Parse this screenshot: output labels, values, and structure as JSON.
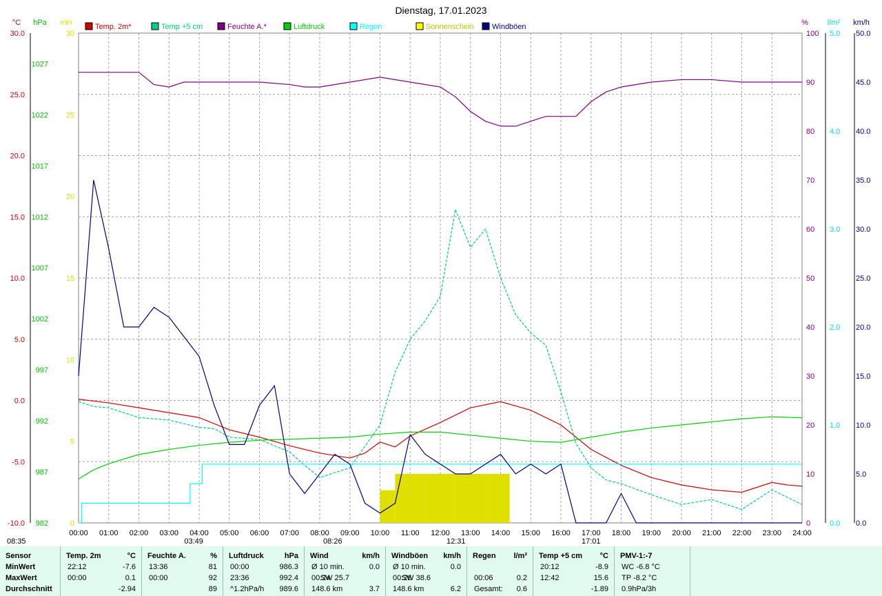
{
  "chart_data": {
    "type": "line",
    "title": "Dienstag, 17.01.2023",
    "x_ticks": [
      "00:00",
      "01:00",
      "02:00",
      "03:00",
      "04:00",
      "05:00",
      "06:00",
      "07:00",
      "08:00",
      "09:00",
      "10:00",
      "11:00",
      "12:00",
      "13:00",
      "14:00",
      "15:00",
      "16:00",
      "17:00",
      "18:00",
      "19:00",
      "20:00",
      "21:00",
      "22:00",
      "23:00",
      "24:00"
    ],
    "axes": {
      "temp": {
        "unit": "°C",
        "ylim": [
          -10,
          30
        ],
        "ticks": [
          "30.0",
          "25.0",
          "20.0",
          "15.0",
          "10.0",
          "5.0",
          "0.0",
          "-5.0",
          "-10.0"
        ],
        "color": "#d00000"
      },
      "pressure": {
        "unit": "hPa",
        "ylim": [
          982,
          1030
        ],
        "ticks": [
          "1027",
          "1022",
          "1017",
          "1012",
          "1007",
          "1002",
          "997",
          "992",
          "987",
          "982"
        ],
        "color": "#00c000"
      },
      "sun": {
        "unit": "min",
        "ylim": [
          0,
          30
        ],
        "ticks": [
          "30",
          "25",
          "20",
          "15",
          "10",
          "5",
          "0"
        ],
        "color": "#e0e000"
      },
      "humidity": {
        "unit": "%",
        "ylim": [
          0,
          100
        ],
        "ticks": [
          "100",
          "90",
          "80",
          "70",
          "60",
          "50",
          "40",
          "30",
          "20",
          "10",
          "0"
        ],
        "color": "#800080"
      },
      "rain": {
        "unit": "l/m²",
        "ylim": [
          0,
          5
        ],
        "ticks": [
          "5.0",
          "4.0",
          "3.0",
          "2.0",
          "1.0",
          "0.0"
        ],
        "color": "#00e0e0"
      },
      "wind": {
        "unit": "km/h",
        "ylim": [
          0,
          50
        ],
        "ticks": [
          "50.0",
          "45.0",
          "40.0",
          "35.0",
          "30.0",
          "25.0",
          "20.0",
          "15.0",
          "10.0",
          "5.0",
          "0.0"
        ],
        "color": "#000080"
      }
    },
    "legend": [
      {
        "name": "Temp. 2m*",
        "color": "#d00000"
      },
      {
        "name": "Temp +5 cm",
        "color": "#00d080"
      },
      {
        "name": "Feuchte A.*",
        "color": "#800080"
      },
      {
        "name": "Luftdruck",
        "color": "#00d000"
      },
      {
        "name": "Regen",
        "color": "#00ffff"
      },
      {
        "name": "Sonnenschein",
        "color": "#ffff00"
      },
      {
        "name": "Windböen",
        "color": "#000080"
      }
    ],
    "markers": [
      "03:49",
      "08:26",
      "12:31",
      "17:01",
      "08:35"
    ],
    "series": [
      {
        "name": "Temp. 2m*",
        "axis": "temp",
        "x": [
          0,
          1,
          2,
          3,
          4,
          5,
          6,
          7,
          8,
          9,
          9.5,
          10,
          10.5,
          11,
          12,
          13,
          14,
          15,
          16,
          17,
          18,
          19,
          20,
          21,
          22,
          23,
          23.5,
          24
        ],
        "values": [
          0.1,
          -0.2,
          -0.6,
          -1.0,
          -1.4,
          -2.4,
          -3.0,
          -3.7,
          -4.3,
          -4.7,
          -4.3,
          -3.4,
          -3.8,
          -2.9,
          -1.8,
          -0.6,
          -0.1,
          -0.8,
          -2.0,
          -4.0,
          -5.3,
          -6.3,
          -6.9,
          -7.3,
          -7.5,
          -6.7,
          -6.9,
          -7.0
        ]
      },
      {
        "name": "Temp +5 cm",
        "axis": "temp",
        "x": [
          0,
          0.5,
          1,
          1.5,
          2,
          3,
          4,
          4.5,
          5,
          6,
          7,
          7.5,
          8,
          9,
          10,
          10.5,
          11,
          11.5,
          12,
          12.5,
          13,
          13.5,
          14,
          14.5,
          15,
          15.5,
          16,
          16.5,
          17,
          17.5,
          18,
          19,
          20,
          21,
          22,
          23,
          24
        ],
        "values": [
          -0.1,
          -0.5,
          -0.6,
          -1.0,
          -1.4,
          -1.6,
          -2.2,
          -2.3,
          -3.0,
          -3.2,
          -4.2,
          -5.3,
          -6.3,
          -5.5,
          -2.0,
          2.3,
          5.0,
          6.5,
          8.5,
          15.6,
          12.5,
          14.0,
          10.0,
          7.0,
          5.5,
          4.5,
          0.7,
          -3.5,
          -5.5,
          -6.5,
          -6.8,
          -7.7,
          -8.5,
          -8.1,
          -8.9,
          -7.3,
          -8.5
        ]
      },
      {
        "name": "Feuchte A.*",
        "axis": "humidity",
        "x": [
          0,
          1,
          2,
          2.5,
          3,
          3.5,
          4,
          5,
          6,
          7,
          7.5,
          8,
          9,
          10,
          11,
          12,
          12.5,
          13,
          13.5,
          14,
          14.5,
          15,
          15.5,
          16,
          16.5,
          17,
          17.5,
          18,
          19,
          20,
          21,
          22,
          23,
          24
        ],
        "values": [
          92,
          92,
          92,
          89.5,
          89,
          90,
          90,
          90,
          90,
          89.5,
          89,
          89,
          90,
          91,
          90,
          89,
          87,
          84,
          82,
          81,
          81,
          82,
          83,
          83,
          83,
          86,
          88,
          89,
          90,
          90.5,
          90.5,
          90,
          90,
          90
        ]
      },
      {
        "name": "Luftdruck",
        "axis": "pressure",
        "x": [
          0,
          0.5,
          1,
          2,
          3,
          4,
          5,
          6,
          7,
          8,
          9,
          10,
          11,
          12,
          13,
          14,
          15,
          16,
          17,
          18,
          19,
          20,
          21,
          22,
          23,
          24
        ],
        "values": [
          986.3,
          987.2,
          987.8,
          988.7,
          989.2,
          989.6,
          989.9,
          990.1,
          990.2,
          990.3,
          990.4,
          990.7,
          990.9,
          990.9,
          990.6,
          990.3,
          990.0,
          989.9,
          990.4,
          990.9,
          991.3,
          991.6,
          991.9,
          992.2,
          992.4,
          992.3
        ]
      },
      {
        "name": "Regen",
        "axis": "rain",
        "x": [
          0,
          0.05,
          0.1,
          3.65,
          3.7,
          4.0,
          4.1,
          4.2,
          24
        ],
        "values": [
          0,
          0,
          0.2,
          0.2,
          0.4,
          0.4,
          0.6,
          0.6,
          0.6
        ]
      },
      {
        "name": "Windböen",
        "axis": "wind",
        "x": [
          0,
          0.5,
          1,
          1.5,
          2,
          2.5,
          3,
          3.5,
          4,
          4.5,
          5,
          5.5,
          6,
          6.5,
          7,
          7.5,
          8,
          8.5,
          9,
          9.5,
          10,
          10.5,
          11,
          11.5,
          12,
          12.5,
          13,
          13.5,
          14,
          14.5,
          15,
          15.5,
          16,
          16.5,
          17,
          17.5,
          18,
          18.5,
          24
        ],
        "values": [
          15,
          35,
          28,
          20,
          20,
          22,
          21,
          19,
          17,
          12,
          8,
          8,
          12,
          14,
          5,
          3,
          5,
          7,
          6,
          2,
          1,
          2,
          9,
          7,
          6,
          5,
          5,
          6,
          7,
          5,
          6,
          5,
          6,
          0,
          0,
          0,
          3,
          0,
          0
        ]
      },
      {
        "name": "Sonnenschein",
        "axis": "sun",
        "x": [
          10,
          10.5,
          11,
          11.5,
          12,
          12.5,
          13,
          13.5,
          14,
          14.3
        ],
        "values": [
          2,
          3,
          3,
          3,
          3,
          3,
          3,
          3,
          3,
          3
        ]
      }
    ]
  },
  "stats": {
    "cols": [
      {
        "head": "Sensor",
        "unit": "",
        "rows": [
          [
            "MinWert",
            "",
            ""
          ],
          [
            "MaxWert",
            "",
            ""
          ],
          [
            "Durchschnitt",
            "",
            ""
          ]
        ]
      },
      {
        "head": "Temp. 2m",
        "unit": "°C",
        "rows": [
          [
            "22:12",
            "",
            "-7.6"
          ],
          [
            "00:00",
            "",
            "0.1"
          ],
          [
            "",
            "",
            "-2.94"
          ]
        ]
      },
      {
        "head": "Feuchte A.",
        "unit": "%",
        "rows": [
          [
            "13:36",
            "",
            "81"
          ],
          [
            "00:00",
            "",
            "92"
          ],
          [
            "",
            "",
            "89"
          ]
        ]
      },
      {
        "head": "Luftdruck",
        "unit": "hPa",
        "rows": [
          [
            "00:00",
            "",
            "986.3"
          ],
          [
            "23:36",
            "",
            "992.4"
          ],
          [
            "^1.2hPa/h",
            "",
            "989.6"
          ]
        ]
      },
      {
        "head": "Wind",
        "unit": "km/h",
        "rows": [
          [
            "Ø 10 min.",
            "",
            "0.0"
          ],
          [
            "00:24",
            "SW 25.7",
            ""
          ],
          [
            "148.6 km",
            "",
            "3.7"
          ]
        ]
      },
      {
        "head": "Windböen",
        "unit": "km/h",
        "rows": [
          [
            "Ø 10 min.",
            "",
            "0.0"
          ],
          [
            "00:26",
            "SW 38.6",
            ""
          ],
          [
            "148.6 km",
            "",
            "6.2"
          ]
        ]
      },
      {
        "head": "Regen",
        "unit": "l/m²",
        "rows": [
          [
            "",
            "",
            ""
          ],
          [
            "00:06",
            "",
            "0.2"
          ],
          [
            "Gesamt:",
            "",
            "0.6"
          ]
        ]
      },
      {
        "head": "Temp +5 cm",
        "unit": "°C",
        "rows": [
          [
            "20:12",
            "",
            "-8.9"
          ],
          [
            "12:42",
            "",
            "15.6"
          ],
          [
            "",
            "",
            "-1.89"
          ]
        ]
      },
      {
        "head": "PMV-1:-7",
        "unit": "",
        "rows": [
          [
            "WC -6.8 °C",
            "",
            ""
          ],
          [
            "TP -8.2 °C",
            "",
            ""
          ],
          [
            "0.9hPa/3h",
            "",
            ""
          ]
        ]
      }
    ]
  }
}
